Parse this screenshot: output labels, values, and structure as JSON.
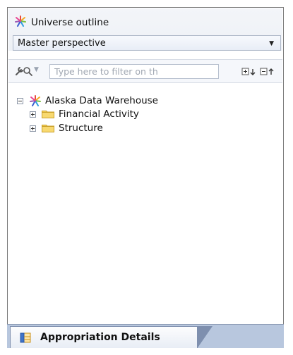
{
  "panel": {
    "title": "Universe outline",
    "title_icon": "universe-icon",
    "perspective": {
      "value": "Master perspective"
    },
    "toolbar": {
      "tool_icon": "wrench-icon",
      "filter_placeholder": "Type here to filter on th",
      "expand_icon": "expand-all-icon",
      "collapse_icon": "collapse-all-icon"
    },
    "tree": {
      "root": {
        "label": "Alaska Data Warehouse",
        "icon": "universe-icon",
        "expanded": true
      },
      "children": [
        {
          "label": "Financial Activity",
          "icon": "folder-icon",
          "expanded": false
        },
        {
          "label": "Structure",
          "icon": "folder-icon",
          "expanded": false
        }
      ]
    }
  },
  "bottom_tabs": [
    {
      "label": "Appropriation Details",
      "icon": "table-icon",
      "active": true
    }
  ],
  "colors": {
    "accent_folder": "#f3c84b",
    "tab_strip": "#b8c7de",
    "border": "#7a7a7a"
  }
}
